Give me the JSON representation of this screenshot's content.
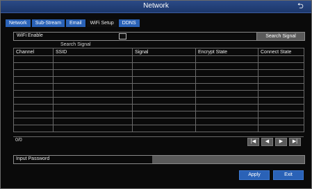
{
  "window": {
    "title": "Network"
  },
  "tabs": [
    "Network",
    "Sub-Stream",
    "Email",
    "WiFi Setup",
    "DDNS"
  ],
  "wifi": {
    "enable_label": "WiFi Enable",
    "search_button": "Search Signal",
    "search_caption": "Search Signal"
  },
  "table": {
    "headers": [
      "Channel",
      "SSID",
      "Signal",
      "Encrypt State",
      "Connect State"
    ],
    "rows": [
      [
        "",
        "",
        "",
        "",
        ""
      ],
      [
        "",
        "",
        "",
        "",
        ""
      ],
      [
        "",
        "",
        "",
        "",
        ""
      ],
      [
        "",
        "",
        "",
        "",
        ""
      ],
      [
        "",
        "",
        "",
        "",
        ""
      ],
      [
        "",
        "",
        "",
        "",
        ""
      ],
      [
        "",
        "",
        "",
        "",
        ""
      ],
      [
        "",
        "",
        "",
        "",
        ""
      ],
      [
        "",
        "",
        "",
        "",
        ""
      ],
      [
        "",
        "",
        "",
        "",
        ""
      ],
      [
        "",
        "",
        "",
        "",
        ""
      ]
    ],
    "count": "0/0"
  },
  "pager": {
    "icons": [
      "first-page-icon",
      "prev-page-icon",
      "next-page-icon",
      "last-page-icon"
    ]
  },
  "password": {
    "label": "Input Password",
    "value": ""
  },
  "buttons": {
    "apply": "Apply",
    "exit": "Exit"
  }
}
